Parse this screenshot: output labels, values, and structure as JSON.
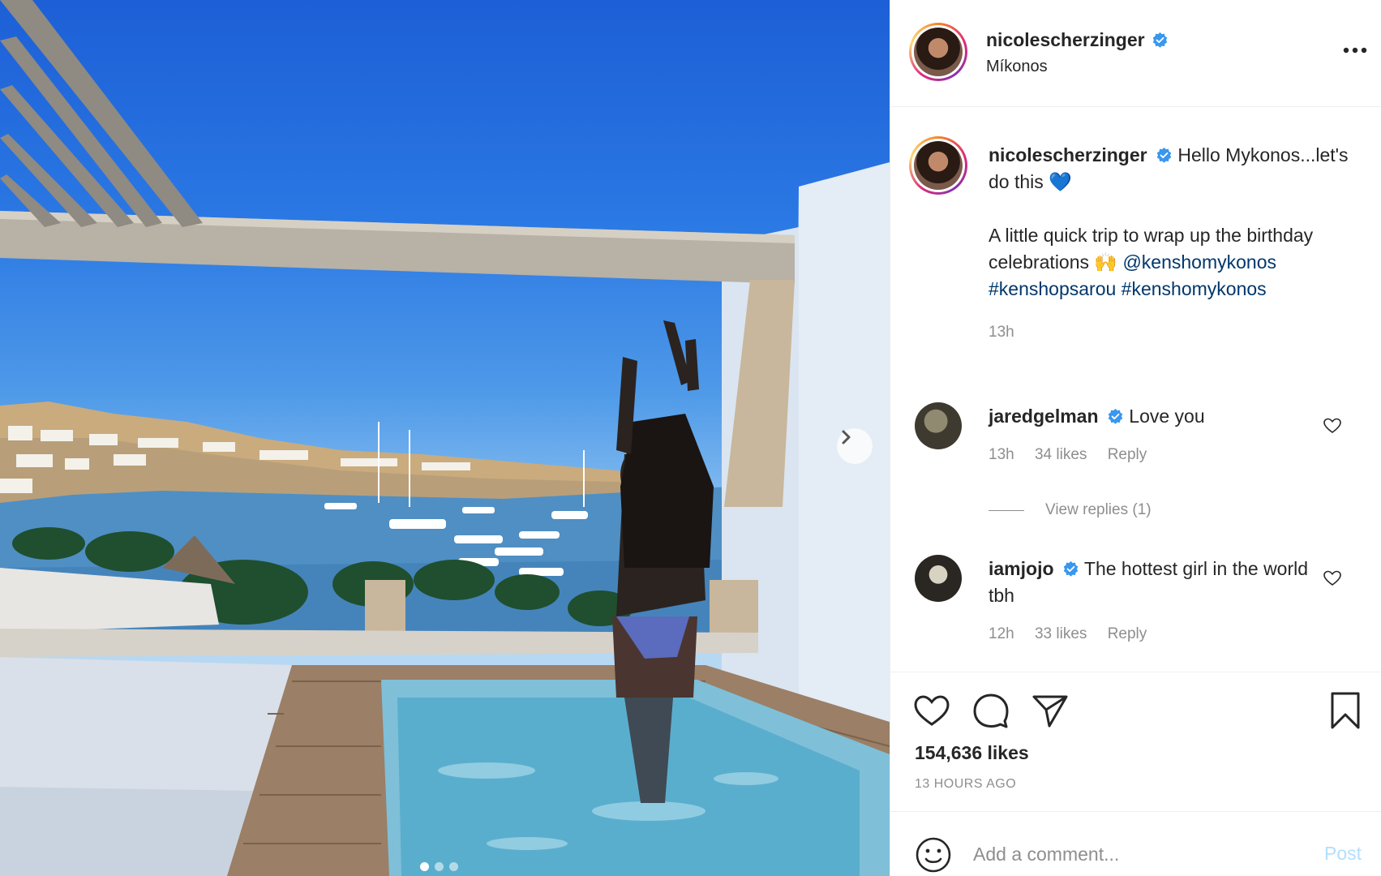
{
  "post": {
    "username": "nicolescherzinger",
    "location": "Míkonos",
    "caption_line1": "Hello Mykonos...let's do this",
    "caption_heart": "💙",
    "caption_line2": "A little quick trip to wrap up the birthday celebrations",
    "caption_emoji": "🙌",
    "caption_tags": "@kenshomykonos #kenshopsarou #kenshomykonos",
    "caption_time": "13h",
    "likes": "154,636 likes",
    "time_ago": "13 HOURS AGO"
  },
  "comments": [
    {
      "username": "jaredgelman",
      "text": "Love you",
      "time": "13h",
      "likes": "34 likes",
      "reply": "Reply"
    },
    {
      "username": "iamjojo",
      "text": "The hottest girl in the world tbh",
      "time": "12h",
      "likes": "33 likes",
      "reply": "Reply"
    }
  ],
  "view_replies": "View replies (1)",
  "add_comment": {
    "placeholder": "Add a comment...",
    "post_label": "Post"
  },
  "carousel": {
    "total": 3,
    "active_index": 1
  },
  "icons": {
    "more": "more-options-icon",
    "like": "heart-icon",
    "comment": "comment-icon",
    "share": "paper-plane-icon",
    "save": "bookmark-icon",
    "emoji": "smiley-icon",
    "next": "chevron-right-icon",
    "verified": "verified-badge-icon"
  },
  "colors": {
    "verified": "#3897f0",
    "link": "#00376b",
    "muted": "#8e8e8e",
    "post_disabled": "#b2dffc"
  }
}
